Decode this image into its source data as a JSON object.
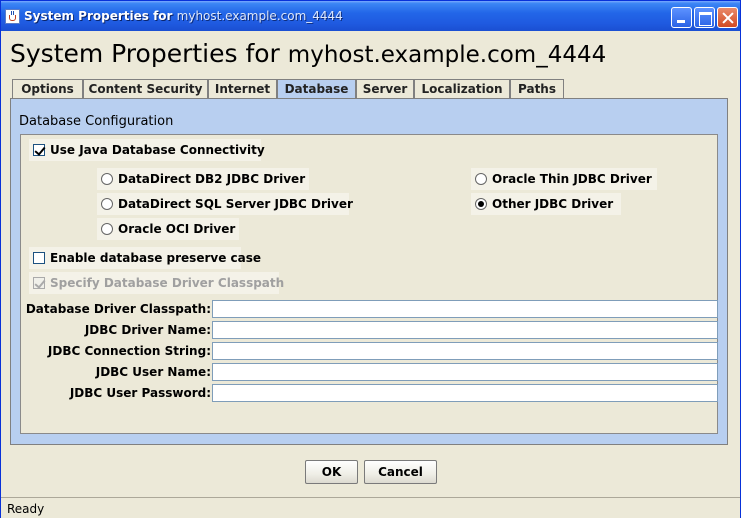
{
  "window": {
    "title": "System Properties for",
    "title_host": "myhost.example.com_4444"
  },
  "heading": {
    "prefix": "System Properties for",
    "host": "myhost.example.com_4444"
  },
  "tabs": [
    {
      "label": "Options",
      "active": false
    },
    {
      "label": "Content Security",
      "active": false
    },
    {
      "label": "Internet",
      "active": false
    },
    {
      "label": "Database",
      "active": true
    },
    {
      "label": "Server",
      "active": false
    },
    {
      "label": "Localization",
      "active": false
    },
    {
      "label": "Paths",
      "active": false
    }
  ],
  "database": {
    "section_title": "Database Configuration",
    "use_jdbc": {
      "label": "Use Java Database Connectivity",
      "checked": true
    },
    "drivers": [
      {
        "label": "DataDirect DB2 JDBC Driver",
        "selected": false
      },
      {
        "label": "DataDirect SQL Server JDBC Driver",
        "selected": false
      },
      {
        "label": "Oracle OCI Driver",
        "selected": false
      },
      {
        "label": "Oracle Thin JDBC Driver",
        "selected": false
      },
      {
        "label": "Other JDBC Driver",
        "selected": true
      }
    ],
    "preserve_case": {
      "label": "Enable database preserve case",
      "checked": false
    },
    "specify_classpath": {
      "label": "Specify Database Driver Classpath",
      "checked": true,
      "enabled": false
    },
    "fields": [
      {
        "label": "Database Driver Classpath:",
        "value": ""
      },
      {
        "label": "JDBC Driver Name:",
        "value": ""
      },
      {
        "label": "JDBC Connection String:",
        "value": ""
      },
      {
        "label": "JDBC User Name:",
        "value": ""
      },
      {
        "label": "JDBC User Password:",
        "value": ""
      }
    ]
  },
  "buttons": {
    "ok": "OK",
    "cancel": "Cancel"
  },
  "status": "Ready",
  "colors": {
    "titlebar": "#2266e8",
    "tab_active": "#b8cff0",
    "window_bg": "#ece9d8"
  }
}
